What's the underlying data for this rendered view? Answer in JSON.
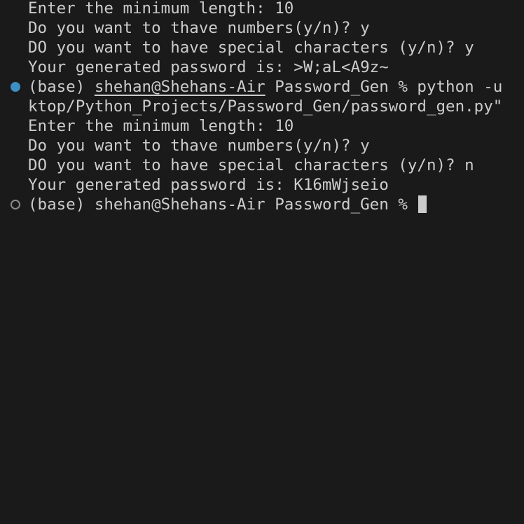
{
  "terminal": {
    "lines": {
      "l1": "Enter the minimum length: 10",
      "l2": "Do you want to thave numbers(y/n)? y",
      "l3": "DO you want to have special characters (y/n)? y",
      "l4": "Your generated password is: >W;aL<A9z~",
      "l6": "ktop/Python_Projects/Password_Gen/password_gen.py\"",
      "l7": "Enter the minimum length: 10",
      "l8": "Do you want to thave numbers(y/n)? y",
      "l9": "DO you want to have special characters (y/n)? n",
      "l10": "Your generated password is: K16mWjseio"
    },
    "prompt1": {
      "env": "(base)",
      "user_host": "shehan@Shehans-Air",
      "cwd": "Password_Gen",
      "symbol": "%",
      "command": "python -u"
    },
    "prompt2": {
      "env": "(base)",
      "user_host": "shehan@Shehans-Air",
      "cwd": "Password_Gen",
      "symbol": "%"
    },
    "marker_colors": {
      "filled": "#3d8fc4",
      "empty": "#8a8a8a"
    }
  }
}
